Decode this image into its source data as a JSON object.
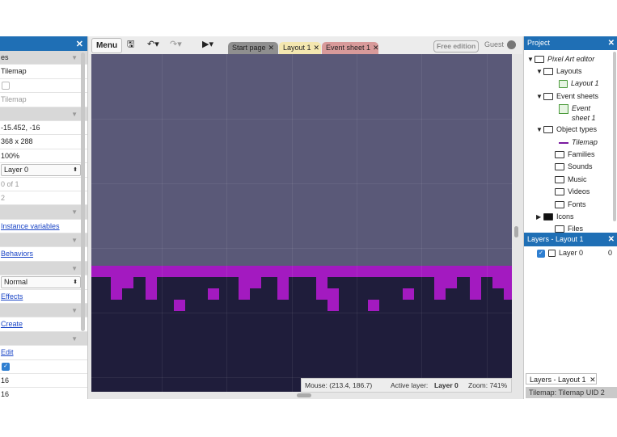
{
  "properties": {
    "rows": [
      {
        "type": "section",
        "text": "es"
      },
      {
        "type": "text",
        "text": "Tilemap"
      },
      {
        "type": "checkbox",
        "checked": false
      },
      {
        "type": "gray",
        "text": "Tilemap"
      },
      {
        "type": "section",
        "text": ""
      },
      {
        "type": "text",
        "text": "-15.452, -16"
      },
      {
        "type": "text",
        "text": "368 x 288"
      },
      {
        "type": "text",
        "text": "100%"
      },
      {
        "type": "select",
        "text": "Layer 0"
      },
      {
        "type": "gray",
        "text": "0 of 1"
      },
      {
        "type": "gray",
        "text": "2"
      },
      {
        "type": "section",
        "text": ""
      },
      {
        "type": "link",
        "text": "Instance variables"
      },
      {
        "type": "section",
        "text": ""
      },
      {
        "type": "link",
        "text": "Behaviors"
      },
      {
        "type": "section",
        "text": ""
      },
      {
        "type": "select",
        "text": "Normal"
      },
      {
        "type": "link",
        "text": "Effects"
      },
      {
        "type": "section",
        "text": ""
      },
      {
        "type": "link",
        "text": "Create"
      },
      {
        "type": "section",
        "text": ""
      },
      {
        "type": "link",
        "text": "Edit"
      },
      {
        "type": "checkbox",
        "checked": true
      },
      {
        "type": "text",
        "text": "16"
      },
      {
        "type": "text",
        "text": "16"
      }
    ]
  },
  "toolbar": {
    "menu_label": "Menu",
    "save_icon": "save-icon",
    "undo_icon": "undo-icon",
    "redo_icon": "redo-icon",
    "play_icon": "play-icon",
    "tabs": [
      {
        "label": "Start page",
        "state": "inactive",
        "color": "#8f8f8f"
      },
      {
        "label": "Layout 1",
        "state": "active",
        "color": "#f4e7b0"
      },
      {
        "label": "Event sheet 1",
        "state": "inactive",
        "color": "#d89a9a"
      }
    ],
    "edition_badge": "Free edition",
    "user": "Guest"
  },
  "status": {
    "mouse": "Mouse: (213.4, 186.7)",
    "layer_label": "Active layer:",
    "layer_value": "Layer 0",
    "zoom": "Zoom: 741%"
  },
  "project": {
    "title": "Project",
    "items": [
      {
        "label": "Pixel Art editor",
        "icon": "folder",
        "expand": "open",
        "italic": true
      },
      {
        "label": "Layouts",
        "icon": "folder",
        "expand": "open",
        "italic": false
      },
      {
        "label": "Layout 1",
        "icon": "layout",
        "expand": "none",
        "italic": true
      },
      {
        "label": "Event sheets",
        "icon": "folder",
        "expand": "open",
        "italic": false
      },
      {
        "label": "Event sheet 1",
        "icon": "eventsheet",
        "expand": "none",
        "italic": true
      },
      {
        "label": "Object types",
        "icon": "folder",
        "expand": "open",
        "italic": false
      },
      {
        "label": "Tilemap",
        "icon": "tilemap",
        "expand": "none",
        "italic": true
      },
      {
        "label": "Families",
        "icon": "folder",
        "expand": "none",
        "italic": false
      },
      {
        "label": "Sounds",
        "icon": "folder",
        "expand": "none",
        "italic": false
      },
      {
        "label": "Music",
        "icon": "folder",
        "expand": "none",
        "italic": false
      },
      {
        "label": "Videos",
        "icon": "folder",
        "expand": "none",
        "italic": false
      },
      {
        "label": "Fonts",
        "icon": "folder",
        "expand": "none",
        "italic": false
      },
      {
        "label": "Icons",
        "icon": "folder-filled",
        "expand": "closed",
        "italic": false
      },
      {
        "label": "Files",
        "icon": "folder",
        "expand": "none",
        "italic": false
      }
    ]
  },
  "layers": {
    "title": "Layers - Layout 1",
    "items": [
      {
        "name": "Layer 0",
        "index": "0",
        "visible": true,
        "locked": false
      }
    ],
    "bottom_tab": "Layers - Layout 1",
    "tilemap_tab": "Tilemap: Tilemap UID 2"
  },
  "colors": {
    "accent_blue": "#1f6fb5",
    "sky": "#5a5978",
    "ground": "#1f1d3b",
    "tile_purple": "#a31ac0"
  }
}
